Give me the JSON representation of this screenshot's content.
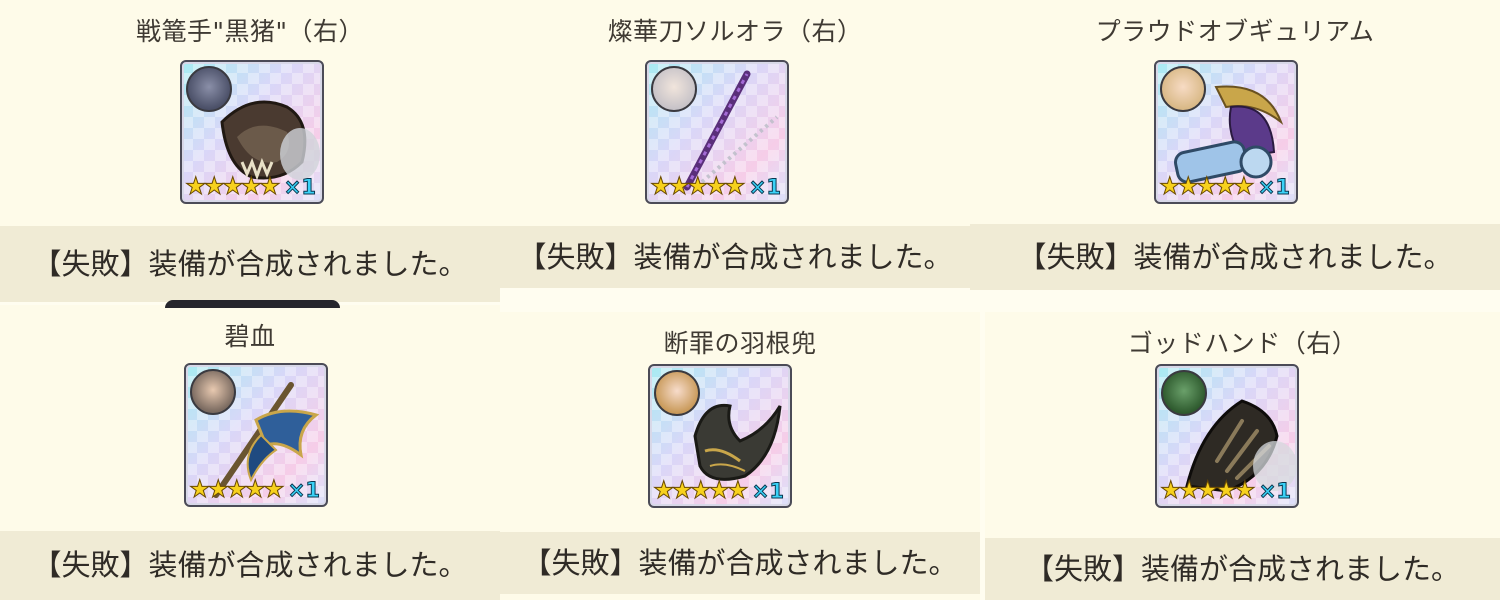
{
  "results": [
    {
      "name": "戦篭手\"黒猪\"（右）",
      "stars": "★★★★★",
      "count": "×1",
      "message": "【失敗】装備が合成されました。"
    },
    {
      "name": "燦華刀ソルオラ（右）",
      "stars": "★★★★★",
      "count": "×1",
      "message": "【失敗】装備が合成されました。"
    },
    {
      "name": "プラウドオブギュリアム",
      "stars": "★★★★★",
      "count": "×1",
      "message": "【失敗】装備が合成されました。"
    },
    {
      "name": "碧血",
      "stars": "★★★★★",
      "count": "×1",
      "message": "【失敗】装備が合成されました。"
    },
    {
      "name": "断罪の羽根兜",
      "stars": "★★★★★",
      "count": "×1",
      "message": "【失敗】装備が合成されました。"
    },
    {
      "name": "ゴッドハンド（右）",
      "stars": "★★★★★",
      "count": "×1",
      "message": "【失敗】装備が合成されました。"
    }
  ],
  "colors": {
    "panel_bg": "#fefbe9",
    "band_bg": "#f0ebd5",
    "star": "#f7d11d",
    "count": "#3ad2f7"
  }
}
